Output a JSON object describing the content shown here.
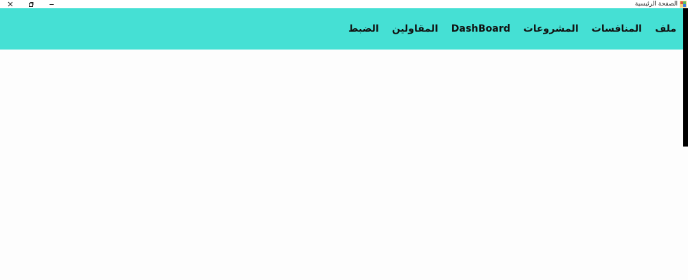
{
  "window": {
    "title": "الصفحة الرئيسية",
    "app_icon": "app-icon",
    "controls": {
      "close_icon": "close-icon",
      "restore_icon": "restore-icon",
      "minimize_icon": "minimize-icon"
    }
  },
  "menubar": {
    "background": "#45e0d4",
    "items": [
      {
        "label": "ملف"
      },
      {
        "label": "المنافسات"
      },
      {
        "label": "المشروعات"
      },
      {
        "label": "DashBoard"
      },
      {
        "label": "المقاولين"
      },
      {
        "label": "الضبط"
      }
    ]
  }
}
